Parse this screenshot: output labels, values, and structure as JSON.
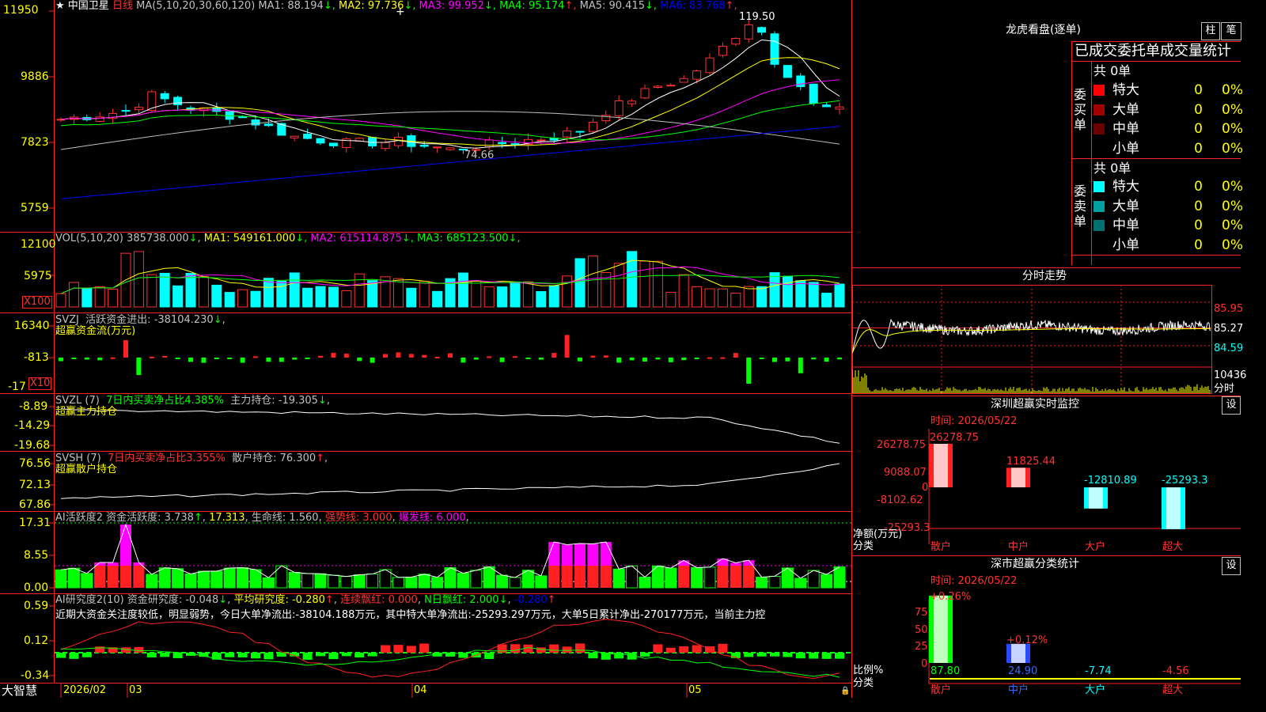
{
  "main": {
    "title_prefix": "★",
    "stock_name": "中国卫星",
    "period": "日线",
    "ma_label": "MA(5,10,20,30,60,120)",
    "ma": [
      {
        "label": "MA1:",
        "value": "88.194",
        "arrow": "↓",
        "color": "#c0c0c0"
      },
      {
        "label": "MA2:",
        "value": "97.736",
        "arrow": "↓",
        "color": "#ffff00"
      },
      {
        "label": "MA3:",
        "value": "99.952",
        "arrow": "↓",
        "color": "#ff00ff"
      },
      {
        "label": "MA4:",
        "value": "95.174",
        "arrow": "↑",
        "color": "#00ff00"
      },
      {
        "label": "MA5:",
        "value": "90.415",
        "arrow": "↓",
        "color": "#c0c0c0"
      },
      {
        "label": "MA6:",
        "value": "83.768",
        "arrow": "↑",
        "color": "#0000ff"
      }
    ],
    "y_ticks": [
      "11950",
      "9886",
      "7823",
      "5759"
    ],
    "high_label": "119.50",
    "low_label": "74.66"
  },
  "vol": {
    "label": "VOL(5,10,20)",
    "value": "385738.000",
    "arrow": "↓",
    "ma": [
      {
        "label": "MA1:",
        "value": "549161.000",
        "arrow": "↓",
        "color": "#ffff00"
      },
      {
        "label": "MA2:",
        "value": "615114.875",
        "arrow": "↓",
        "color": "#ff00ff"
      },
      {
        "label": "MA3:",
        "value": "685123.500",
        "arrow": "↓",
        "color": "#00ff00"
      }
    ],
    "y_ticks": [
      "12100",
      "5975"
    ],
    "unit": "X100"
  },
  "svzj": {
    "label": "SVZJ",
    "field": "活跃资金进出:",
    "value": "-38104.230",
    "arrow": "↓",
    "name": "超赢资金流(万元)",
    "y_ticks": [
      "16340",
      "-813",
      "-17"
    ],
    "unit": "X10"
  },
  "svzl": {
    "label": "SVZL (7)",
    "ratio": "7日内买卖净占比4.385%",
    "field": "主力持仓:",
    "value": "-19.305",
    "arrow": "↓",
    "name": "超赢主力持仓",
    "y_ticks": [
      "-8.89",
      "-14.29",
      "-19.68"
    ]
  },
  "svsh": {
    "label": "SVSH (7)",
    "ratio": "7日内买卖净占比3.355%",
    "field": "散户持仓:",
    "value": "76.300",
    "arrow": "↑",
    "name": "超赢散户持仓",
    "y_ticks": [
      "76.56",
      "72.13",
      "67.86"
    ]
  },
  "ai1": {
    "label": "AI活跃度2",
    "f1": "资金活跃度:",
    "v1": "3.738",
    "a1": "↑",
    "v2": "17.313",
    "f3": "生命线:",
    "v3": "1.560",
    "f4": "强势线:",
    "v4": "3.000",
    "f5": "爆发线:",
    "v5": "6.000",
    "y_ticks": [
      "17.31",
      "8.55",
      "0.00"
    ]
  },
  "ai2": {
    "label": "AI研究度2(10)",
    "f1": "资金研究度:",
    "v1": "-0.048",
    "a1": "↓",
    "f2": "平均研究度:",
    "v2": "-0.280",
    "a2": "↑",
    "f3": "连续飘红:",
    "v3": "0.000",
    "f4": "N日飘红:",
    "v4": "2.000",
    "a4": "↓",
    "v5": "-0.280",
    "a5": "↑",
    "note": "近期大资金关注度较低，明显弱势，今日大单净流出:-38104.188万元，其中特大单净流出:-25293.297万元，大单5日累计净出-270177万元，当前主力控",
    "y_ticks": [
      "0.59",
      "0.12",
      "-0.34"
    ]
  },
  "bottom": {
    "brand": "大智慧",
    "dates": [
      "2026/02",
      "03",
      "04",
      "05"
    ]
  },
  "longhu": {
    "title": "龙虎看盘(逐单)",
    "btn1": "柱",
    "btn2": "笔",
    "header": "已成交委托单成交量统计",
    "buy_side": "委买单",
    "sell_side": "委卖单",
    "buy_total": "共 0单",
    "sell_total": "共 0单",
    "buy_rows": [
      {
        "name": "特大",
        "count": "0",
        "pct": "0%",
        "color": "#ff0000"
      },
      {
        "name": "大单",
        "count": "0",
        "pct": "0%",
        "color": "#a00000"
      },
      {
        "name": "中单",
        "count": "0",
        "pct": "0%",
        "color": "#6a0000"
      },
      {
        "name": "小单",
        "count": "0",
        "pct": "0%",
        "color": ""
      }
    ],
    "sell_rows": [
      {
        "name": "特大",
        "count": "0",
        "pct": "0%",
        "color": "#00ffff"
      },
      {
        "name": "大单",
        "count": "0",
        "pct": "0%",
        "color": "#00a0a0"
      },
      {
        "name": "中单",
        "count": "0",
        "pct": "0%",
        "color": "#007070"
      },
      {
        "name": "小单",
        "count": "0",
        "pct": "0%",
        "color": ""
      }
    ]
  },
  "fenshi": {
    "title": "分时走势",
    "prices": [
      "85.95",
      "85.27",
      "84.59"
    ],
    "vol": "10436",
    "vol_unit": "分时"
  },
  "monitor": {
    "title": "深圳超赢实时监控",
    "btn": "设",
    "date": "时间: 2026/05/22",
    "y_ticks": [
      "26278.75",
      "9088.07",
      "0",
      "-8102.62",
      "-25293.3"
    ],
    "y_unit": "净额(万元)",
    "x_unit": "分类",
    "values": [
      "26278.75",
      "11825.44",
      "-12810.89",
      "-25293.3"
    ],
    "categories": [
      "散户",
      "中户",
      "大户",
      "超大"
    ]
  },
  "stats": {
    "title": "深市超赢分类统计",
    "btn": "设",
    "date": "时间: 2026/05/22",
    "y_ticks": [
      "75",
      "50",
      "25",
      "0"
    ],
    "y_unit": "比例%",
    "x_unit": "分类",
    "changes": [
      "+0.26%",
      "+0.12%"
    ],
    "values": [
      "87.80",
      "24.90",
      "-7.74",
      "-4.56"
    ],
    "categories": [
      "散户",
      "中户",
      "大户",
      "超大"
    ]
  }
}
